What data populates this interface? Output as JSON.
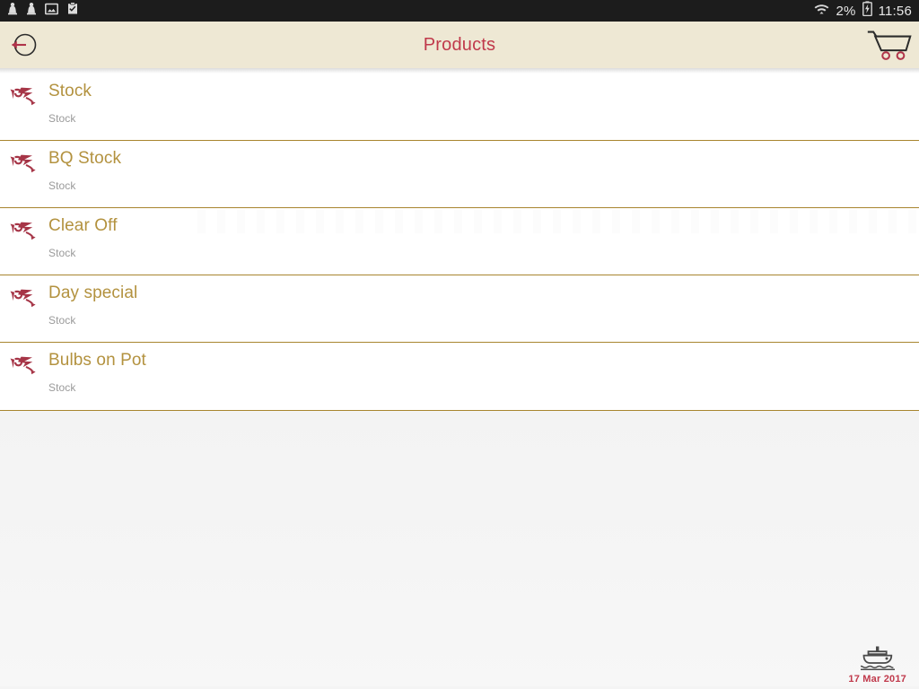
{
  "statusbar": {
    "left_icons": [
      {
        "name": "person-icon"
      },
      {
        "name": "person-icon"
      },
      {
        "name": "image-icon"
      },
      {
        "name": "clipboard-check-icon"
      }
    ],
    "wifi_icon": "wifi-icon",
    "battery_percent": "2%",
    "battery_icon": "battery-charging-icon",
    "clock": "11:56"
  },
  "appbar": {
    "back_icon": "back-arrow-circle-icon",
    "title": "Products",
    "cart_icon": "shopping-cart-icon"
  },
  "list": {
    "items": [
      {
        "icon": "bird-flourish-icon",
        "title": "Stock",
        "subtitle": "Stock"
      },
      {
        "icon": "bird-flourish-icon",
        "title": "BQ Stock",
        "subtitle": "Stock"
      },
      {
        "icon": "bird-flourish-icon",
        "title": "Clear Off",
        "subtitle": "Stock"
      },
      {
        "icon": "bird-flourish-icon",
        "title": "Day special",
        "subtitle": "Stock"
      },
      {
        "icon": "bird-flourish-icon",
        "title": "Bulbs on Pot",
        "subtitle": "Stock"
      }
    ]
  },
  "footer": {
    "stamp_icon": "ship-icon",
    "date": "17 Mar 2017"
  },
  "colors": {
    "statusbar_bg": "#1c1c1c",
    "appbar_bg": "#eee8d4",
    "accent_red": "#c0394b",
    "title_gold": "#b3923f",
    "divider_gold": "#a8852f",
    "subtitle_gray": "#9a9a9a",
    "icon_crimson": "#a63547"
  }
}
